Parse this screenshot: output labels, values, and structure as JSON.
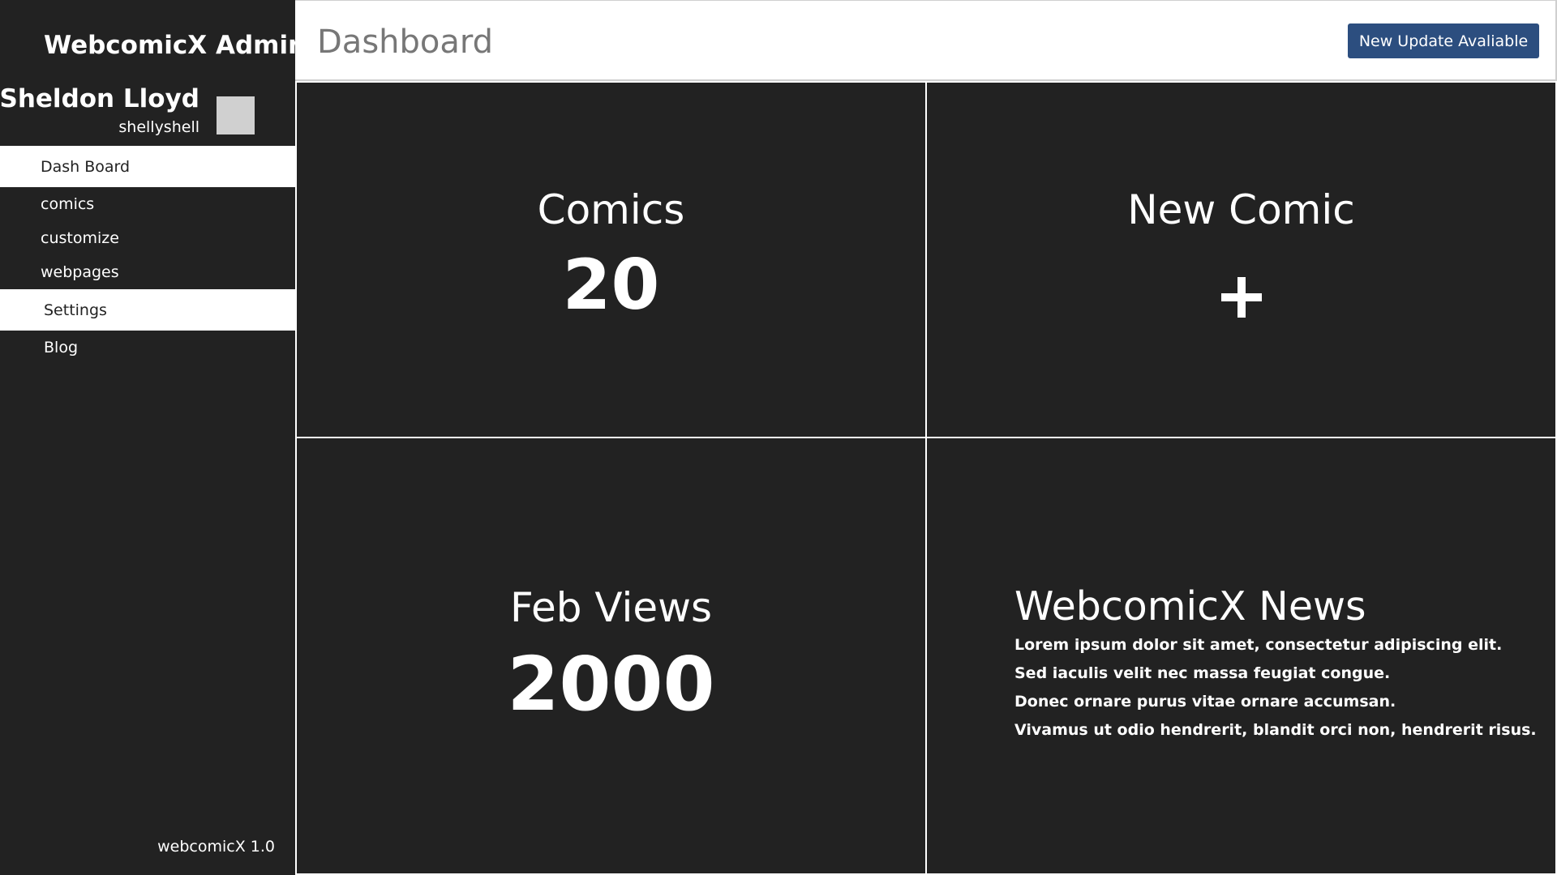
{
  "sidebar": {
    "app_title": "WebcomicX Admin",
    "user": {
      "name": "Sheldon Lloyd",
      "handle": "shellyshell"
    },
    "items": [
      {
        "label": "Dash Board",
        "active": true
      },
      {
        "label": "comics",
        "active": false
      },
      {
        "label": "customize",
        "active": false
      },
      {
        "label": "webpages",
        "active": false
      },
      {
        "label": "Settings",
        "active": true
      },
      {
        "label": "Blog",
        "active": false
      }
    ],
    "version": "webcomicX 1.0"
  },
  "header": {
    "title": "Dashboard",
    "update_button": "New Update Avaliable"
  },
  "tiles": {
    "comics": {
      "title": "Comics",
      "value": "20"
    },
    "new_comic": {
      "title": "New Comic",
      "icon": "plus-icon"
    },
    "feb_views": {
      "title": "Feb Views",
      "value": "2000"
    },
    "news": {
      "title": "WebcomicX News",
      "lines": [
        "Lorem ipsum dolor sit amet, consectetur adipiscing elit.",
        "Sed iaculis velit nec massa feugiat congue.",
        "Donec ornare purus vitae ornare accumsan.",
        "Vivamus ut odio hendrerit, blandit orci non, hendrerit risus."
      ]
    }
  },
  "colors": {
    "background": "#222222",
    "header_bg": "#ffffff",
    "accent_button": "#2c4e7f",
    "title_gray": "#777777",
    "avatar_placeholder": "#d0d0d0"
  }
}
